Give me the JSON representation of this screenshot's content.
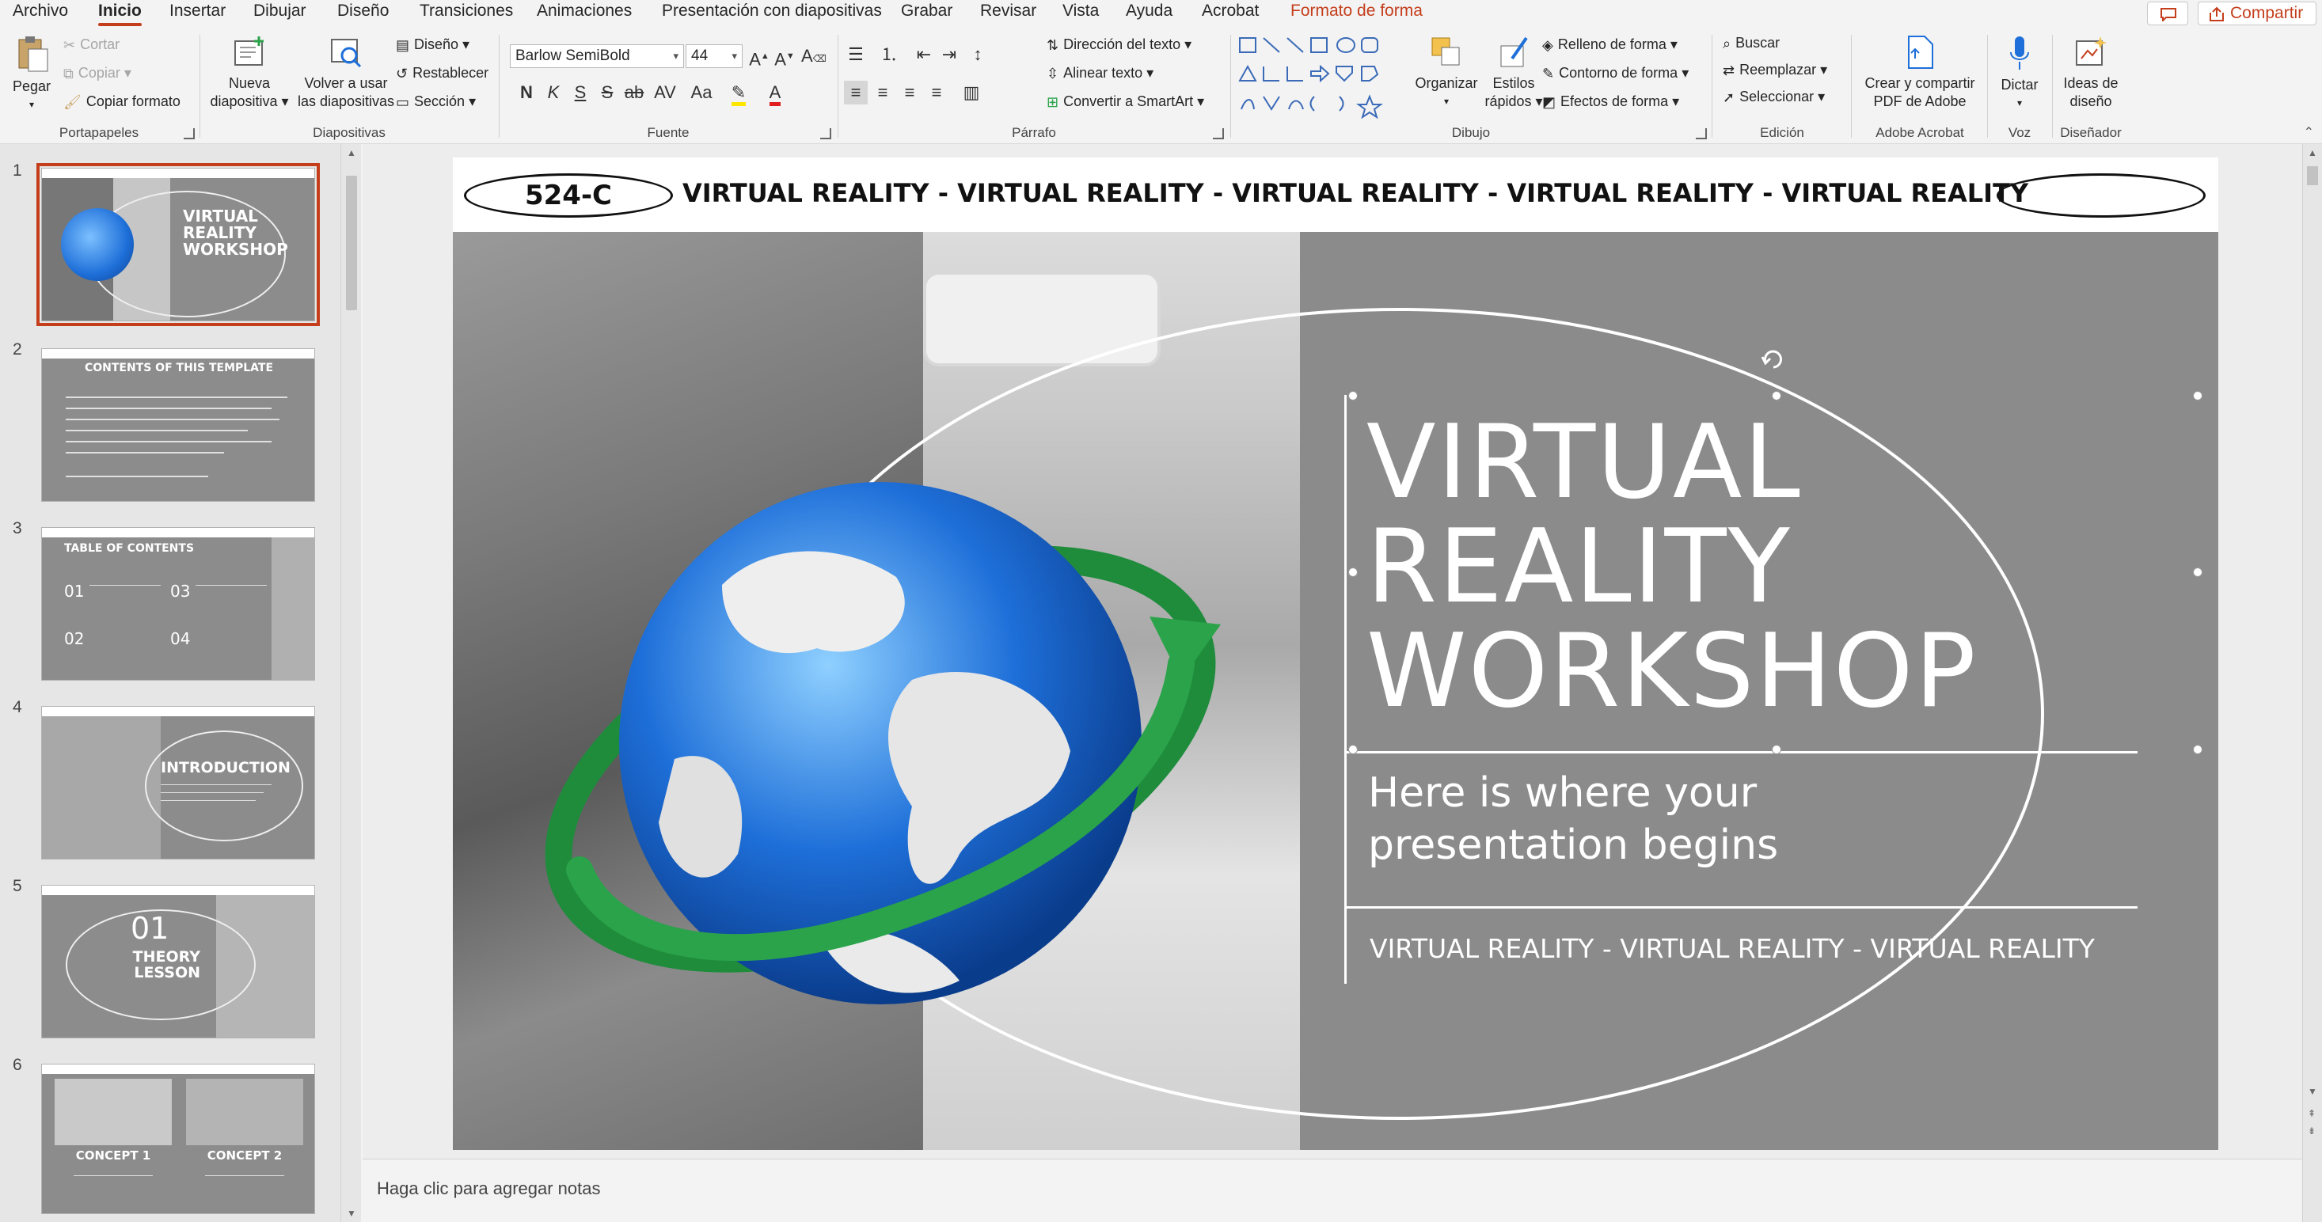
{
  "menu": {
    "tabs": [
      "Archivo",
      "Inicio",
      "Insertar",
      "Dibujar",
      "Diseño",
      "Transiciones",
      "Animaciones",
      "Presentación con diapositivas",
      "Grabar",
      "Revisar",
      "Vista",
      "Ayuda",
      "Acrobat",
      "Formato de forma"
    ],
    "active_tab": "Inicio",
    "share_label": "Compartir"
  },
  "ribbon": {
    "clipboard": {
      "paste": "Pegar",
      "cut": "Cortar",
      "copy": "Copiar",
      "format_painter": "Copiar formato",
      "label": "Portapapeles"
    },
    "slides": {
      "new_slide_1": "Nueva",
      "new_slide_2": "diapositiva",
      "reuse_1": "Volver a usar",
      "reuse_2": "las diapositivas",
      "layout": "Diseño",
      "reset": "Restablecer",
      "section": "Sección",
      "label": "Diapositivas"
    },
    "font": {
      "font_name": "Barlow SemiBold",
      "font_size": "44",
      "bold": "N",
      "italic": "K",
      "underline": "S",
      "strike": "S",
      "label": "Fuente"
    },
    "paragraph": {
      "text_direction": "Dirección del texto",
      "align_text": "Alinear texto",
      "smartart": "Convertir a SmartArt",
      "label": "Párrafo"
    },
    "drawing": {
      "arrange": "Organizar",
      "quick_styles_1": "Estilos",
      "quick_styles_2": "rápidos",
      "fill": "Relleno de forma",
      "outline": "Contorno de forma",
      "effects": "Efectos de forma",
      "label": "Dibujo"
    },
    "editing": {
      "find": "Buscar",
      "replace": "Reemplazar",
      "select": "Seleccionar",
      "label": "Edición"
    },
    "acrobat": {
      "create_1": "Crear y compartir",
      "create_2": "PDF de Adobe",
      "label": "Adobe Acrobat"
    },
    "voice": {
      "dictate": "Dictar",
      "label": "Voz"
    },
    "designer": {
      "ideas_1": "Ideas de",
      "ideas_2": "diseño",
      "label": "Diseñador"
    }
  },
  "thumbnails": [
    {
      "num": "1",
      "title": "VIRTUAL REALITY WORKSHOP"
    },
    {
      "num": "2",
      "title": "CONTENTS OF THIS TEMPLATE"
    },
    {
      "num": "3",
      "title": "TABLE OF CONTENTS",
      "items": [
        "01",
        "02",
        "03",
        "04"
      ]
    },
    {
      "num": "4",
      "title": "INTRODUCTION"
    },
    {
      "num": "5",
      "title_num": "01",
      "title": "THEORY LESSON"
    },
    {
      "num": "6",
      "concept1": "CONCEPT 1",
      "concept2": "CONCEPT 2"
    }
  ],
  "slide": {
    "tag": "524-C",
    "top_line": "VIRTUAL REALITY  - VIRTUAL REALITY - VIRTUAL REALITY  - VIRTUAL REALITY  - VIRTUAL REALITY",
    "title_lines": [
      "VIRTUAL",
      "REALITY",
      "WORKSHOP"
    ],
    "subtitle_lines": [
      "Here is where your",
      "presentation begins"
    ],
    "footer": "VIRTUAL REALITY  - VIRTUAL REALITY - VIRTUAL REALITY"
  },
  "notes_placeholder": "Haga clic para agregar notas",
  "colors": {
    "accent": "#c43e1c",
    "globe_blue": "#1e6fd9",
    "ring_green": "#2aa34a"
  }
}
